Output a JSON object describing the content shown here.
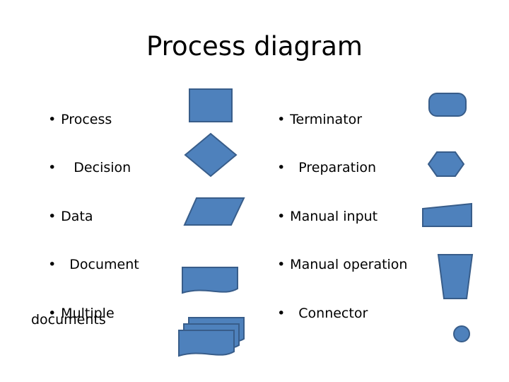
{
  "slide": {
    "title": "Process diagram",
    "background": "#ffffff",
    "text_color": "#000000"
  },
  "shape_style": {
    "fill": "#4E81BC",
    "stroke": "#385D8A",
    "stroke_width": 2
  },
  "columns": {
    "left": {
      "items": [
        {
          "bullet": "•",
          "label": "Process",
          "indent": ""
        },
        {
          "bullet": "•",
          "label": "Decision",
          "indent": "   "
        },
        {
          "bullet": "•",
          "label": "Data",
          "indent": ""
        },
        {
          "bullet": "•",
          "label": "Document",
          "indent": "  "
        },
        {
          "bullet": "•",
          "label": "Multiple",
          "indent": "",
          "wrap_line": "documents"
        }
      ]
    },
    "right": {
      "items": [
        {
          "bullet": "•",
          "label": "Terminator",
          "indent": ""
        },
        {
          "bullet": "•",
          "label": "Preparation",
          "indent": "  "
        },
        {
          "bullet": "•",
          "label": "Manual input",
          "indent": ""
        },
        {
          "bullet": "•",
          "label": "Manual operation",
          "indent": ""
        },
        {
          "bullet": "•",
          "label": "Connector",
          "indent": "  "
        }
      ]
    }
  },
  "shapes": {
    "process": {
      "name": "process-rectangle"
    },
    "decision": {
      "name": "decision-diamond"
    },
    "data": {
      "name": "data-parallelogram"
    },
    "document": {
      "name": "document-shape"
    },
    "multiple_documents": {
      "name": "multiple-documents-stack"
    },
    "terminator": {
      "name": "terminator-rounded-rectangle"
    },
    "preparation": {
      "name": "preparation-hexagon"
    },
    "manual_input": {
      "name": "manual-input-shape"
    },
    "manual_operation": {
      "name": "manual-operation-trapezoid"
    },
    "connector": {
      "name": "connector-circle"
    }
  }
}
